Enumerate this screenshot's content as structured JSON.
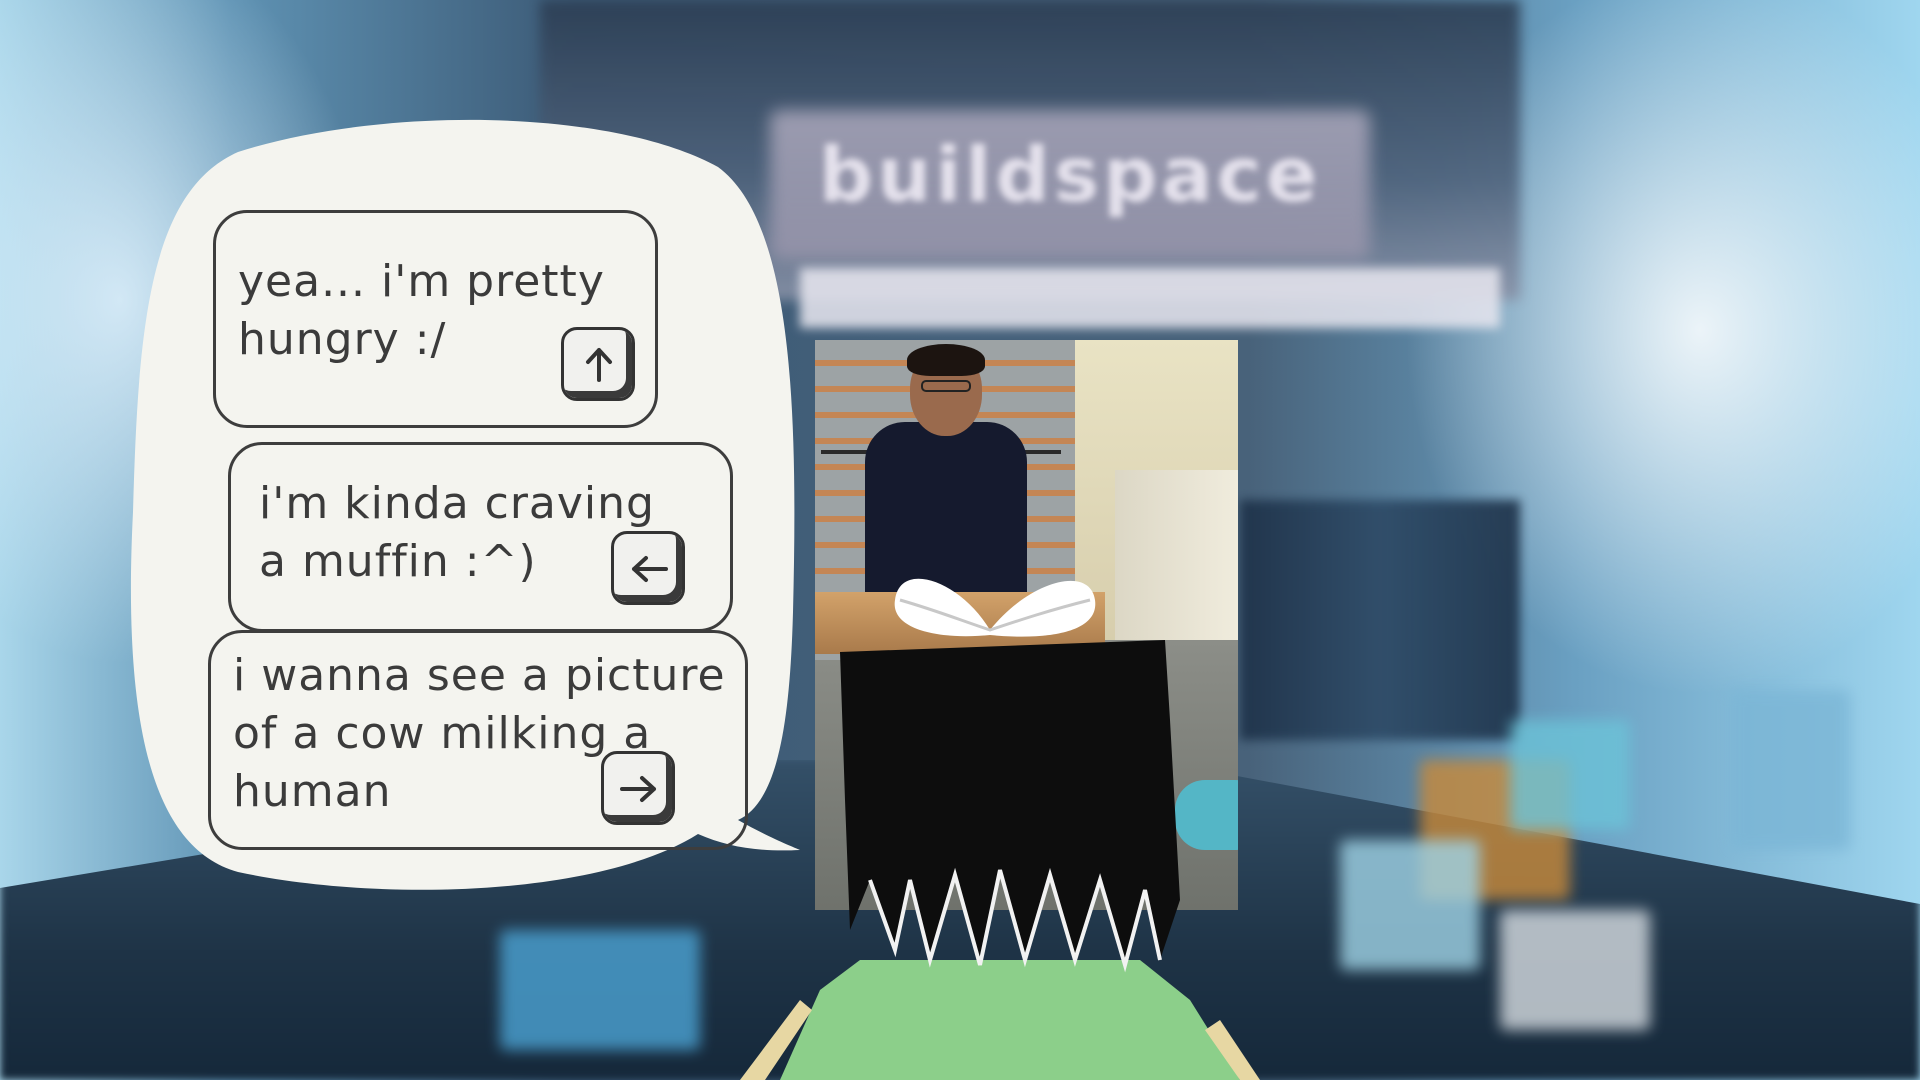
{
  "background": {
    "sign_text": "buildspace"
  },
  "dialogue": {
    "options": [
      {
        "text": "yea... i'm pretty\nhungry :/",
        "key_icon": "arrow-up-key"
      },
      {
        "text": "i'm kinda craving\na muffin :^)",
        "key_icon": "arrow-left-key"
      },
      {
        "text": "i wanna see a picture\nof a cow milking a\nhuman",
        "key_icon": "arrow-right-key"
      }
    ]
  },
  "colors": {
    "bubble_fill": "#f4f4ef",
    "outline": "#3b3b3b",
    "hair": "#0d0d0d",
    "shirt": "#8ccf8a",
    "bow": "#ffffff"
  }
}
